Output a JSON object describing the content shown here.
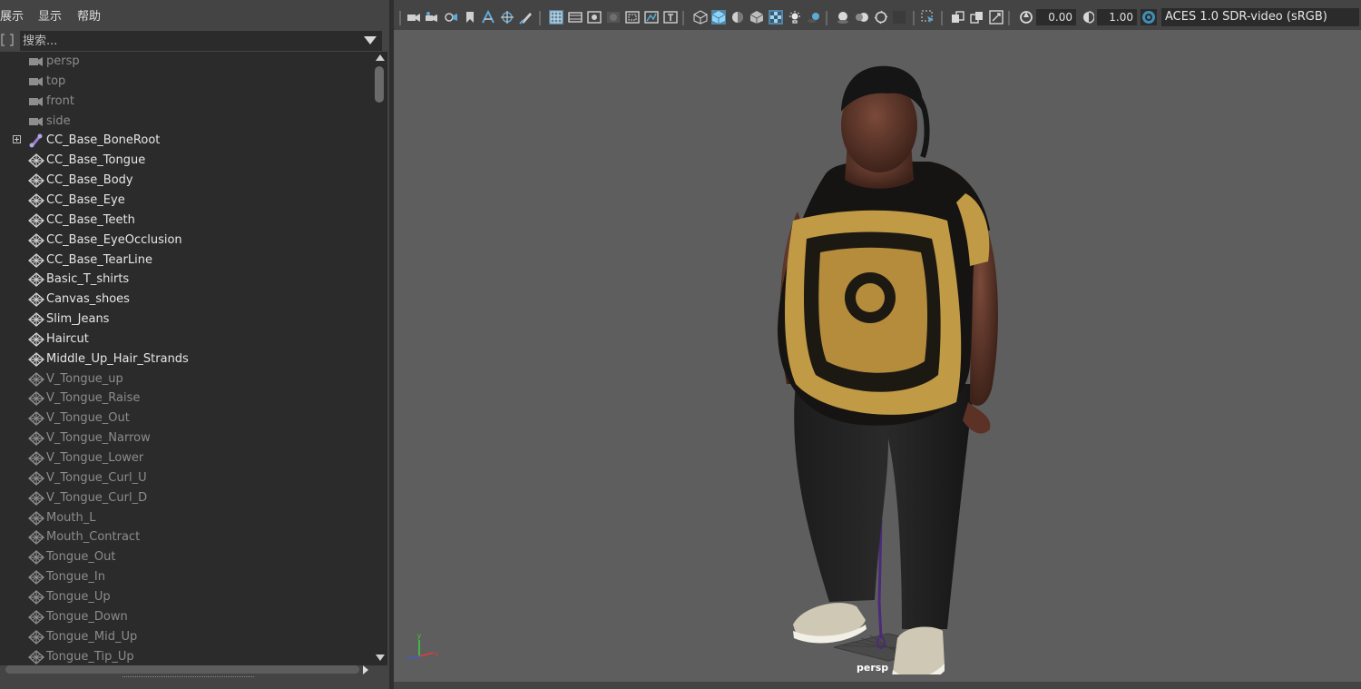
{
  "outliner": {
    "menu": [
      {
        "label": "展示"
      },
      {
        "label": "显示"
      },
      {
        "label": "帮助"
      }
    ],
    "search": {
      "placeholder": "搜索..."
    },
    "items": [
      {
        "label": "persp",
        "icon": "camera-icon",
        "dim": true,
        "expandable": false
      },
      {
        "label": "top",
        "icon": "camera-icon",
        "dim": true,
        "expandable": false
      },
      {
        "label": "front",
        "icon": "camera-icon",
        "dim": true,
        "expandable": false
      },
      {
        "label": "side",
        "icon": "camera-icon",
        "dim": true,
        "expandable": false
      },
      {
        "label": "CC_Base_BoneRoot",
        "icon": "joint-icon",
        "dim": false,
        "expandable": true
      },
      {
        "label": "CC_Base_Tongue",
        "icon": "mesh-icon",
        "dim": false,
        "expandable": false
      },
      {
        "label": "CC_Base_Body",
        "icon": "mesh-icon",
        "dim": false,
        "expandable": false
      },
      {
        "label": "CC_Base_Eye",
        "icon": "mesh-icon",
        "dim": false,
        "expandable": false
      },
      {
        "label": "CC_Base_Teeth",
        "icon": "mesh-icon",
        "dim": false,
        "expandable": false
      },
      {
        "label": "CC_Base_EyeOcclusion",
        "icon": "mesh-icon",
        "dim": false,
        "expandable": false
      },
      {
        "label": "CC_Base_TearLine",
        "icon": "mesh-icon",
        "dim": false,
        "expandable": false
      },
      {
        "label": "Basic_T_shirts",
        "icon": "mesh-icon",
        "dim": false,
        "expandable": false
      },
      {
        "label": "Canvas_shoes",
        "icon": "mesh-icon",
        "dim": false,
        "expandable": false
      },
      {
        "label": "Slim_Jeans",
        "icon": "mesh-icon",
        "dim": false,
        "expandable": false
      },
      {
        "label": "Haircut",
        "icon": "mesh-icon",
        "dim": false,
        "expandable": false
      },
      {
        "label": "Middle_Up_Hair_Strands",
        "icon": "mesh-icon",
        "dim": false,
        "expandable": false
      },
      {
        "label": "V_Tongue_up",
        "icon": "mesh-icon",
        "dim": true,
        "expandable": false
      },
      {
        "label": "V_Tongue_Raise",
        "icon": "mesh-icon",
        "dim": true,
        "expandable": false
      },
      {
        "label": "V_Tongue_Out",
        "icon": "mesh-icon",
        "dim": true,
        "expandable": false
      },
      {
        "label": "V_Tongue_Narrow",
        "icon": "mesh-icon",
        "dim": true,
        "expandable": false
      },
      {
        "label": "V_Tongue_Lower",
        "icon": "mesh-icon",
        "dim": true,
        "expandable": false
      },
      {
        "label": "V_Tongue_Curl_U",
        "icon": "mesh-icon",
        "dim": true,
        "expandable": false
      },
      {
        "label": "V_Tongue_Curl_D",
        "icon": "mesh-icon",
        "dim": true,
        "expandable": false
      },
      {
        "label": "Mouth_L",
        "icon": "mesh-icon",
        "dim": true,
        "expandable": false
      },
      {
        "label": "Mouth_Contract",
        "icon": "mesh-icon",
        "dim": true,
        "expandable": false
      },
      {
        "label": "Tongue_Out",
        "icon": "mesh-icon",
        "dim": true,
        "expandable": false
      },
      {
        "label": "Tongue_In",
        "icon": "mesh-icon",
        "dim": true,
        "expandable": false
      },
      {
        "label": "Tongue_Up",
        "icon": "mesh-icon",
        "dim": true,
        "expandable": false
      },
      {
        "label": "Tongue_Down",
        "icon": "mesh-icon",
        "dim": true,
        "expandable": false
      },
      {
        "label": "Tongue_Mid_Up",
        "icon": "mesh-icon",
        "dim": true,
        "expandable": false
      },
      {
        "label": "Tongue_Tip_Up",
        "icon": "mesh-icon",
        "dim": true,
        "expandable": false
      }
    ]
  },
  "viewport": {
    "toolbar": {
      "exposure_value": "0.00",
      "gamma_value": "1.00",
      "color_space": "ACES 1.0 SDR-video (sRGB)"
    },
    "camera_label": "persp",
    "axes": {
      "x": "x",
      "y": "y",
      "z": "z"
    }
  },
  "colors": {
    "panel_bg": "#444444",
    "tree_bg": "#2b2b2b",
    "viewport_bg": "#5e5e5e",
    "active_icon": "#5ea9d6"
  }
}
